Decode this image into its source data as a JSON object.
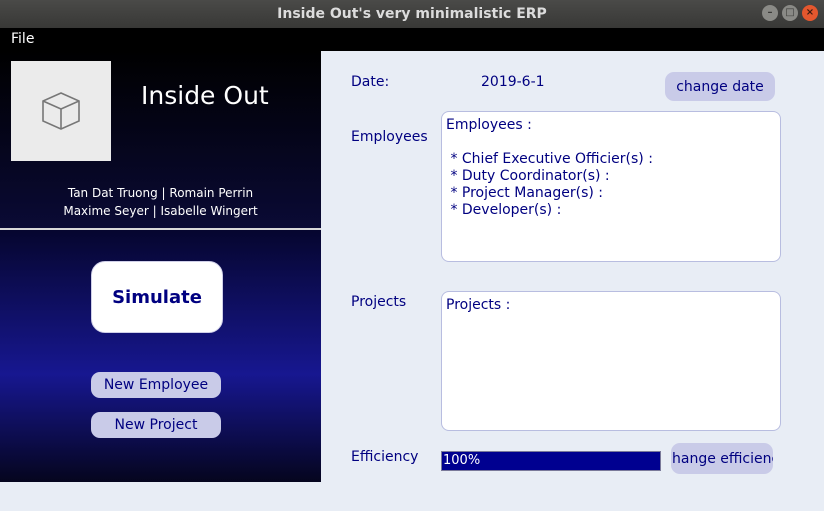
{
  "window": {
    "title": "Inside Out's very minimalistic ERP"
  },
  "menu": {
    "file": "File"
  },
  "company": {
    "name": "Inside Out",
    "authors_line1": "Tan Dat Truong | Romain Perrin",
    "authors_line2": "Maxime Seyer | Isabelle Wingert",
    "logo_icon": "cube-icon"
  },
  "actions": {
    "simulate": "Simulate",
    "new_employee": "New Employee",
    "new_project": "New Project"
  },
  "date": {
    "label": "Date:",
    "value": "2019-6-1",
    "button": "change date"
  },
  "employees": {
    "label": "Employees",
    "text": "Employees :\n\n * Chief Executive Officier(s) :\n * Duty Coordinator(s) :\n * Project Manager(s) :\n * Developer(s) :"
  },
  "projects": {
    "label": "Projects",
    "text": "Projects :"
  },
  "efficiency": {
    "label": "Efficiency",
    "percent": 100,
    "text": "100%",
    "button": "hange efficienc"
  },
  "colors": {
    "accent": "#000080",
    "button_bg": "#c9cbe8",
    "panel_bg": "#e8edf5"
  }
}
